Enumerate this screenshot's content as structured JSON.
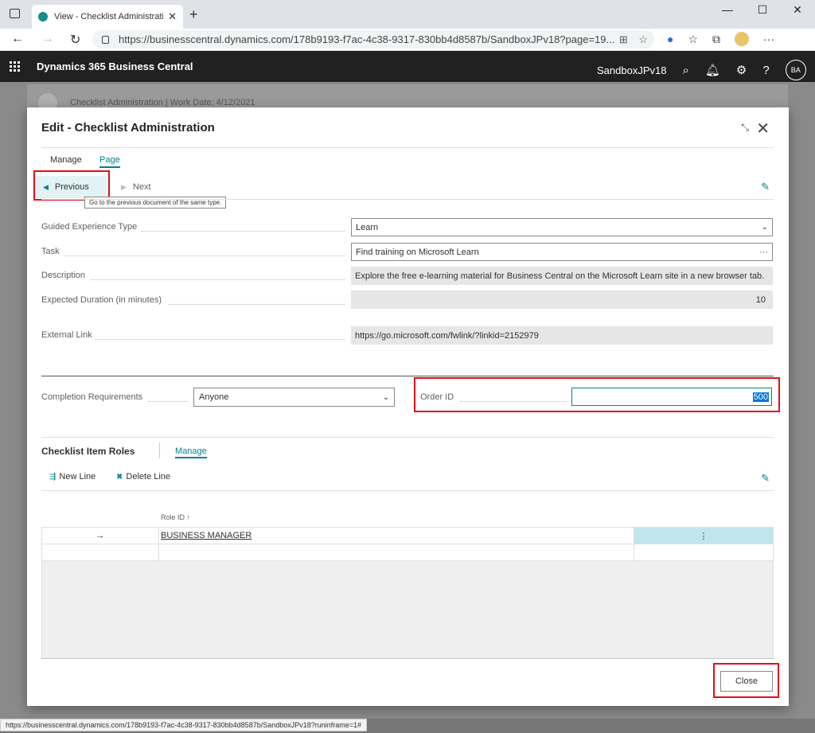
{
  "browser": {
    "tab_title": "View - Checklist Administration -",
    "url": "https://businesscentral.dynamics.com/178b9193-f7ac-4c38-9317-830bb4d8587b/SandboxJPv18?page=19...",
    "status_url": "https://businesscentral.dynamics.com/178b9193-f7ac-4c38-9317-830bb4d8587b/SandboxJPv18?runinframe=1#"
  },
  "app": {
    "title": "Dynamics 365 Business Central",
    "environment": "SandboxJPv18",
    "user_initials": "BA"
  },
  "background_page": {
    "title": "Checklist Administration | Work Date: 4/12/2021"
  },
  "dialog": {
    "title": "Edit - Checklist Administration",
    "menu": {
      "manage": "Manage",
      "page": "Page"
    },
    "actions": {
      "previous": "Previous",
      "next": "Next"
    },
    "tooltip": "Go to the previous document of the same type.",
    "fields": {
      "guided_type": {
        "label": "Guided Experience Type",
        "value": "Learn"
      },
      "task": {
        "label": "Task",
        "value": "Find training on Microsoft Learn"
      },
      "description": {
        "label": "Description",
        "value": "Explore the free e-learning material for Business Central on the Microsoft Learn site in a new browser tab."
      },
      "duration": {
        "label": "Expected Duration (in minutes)",
        "value": "10"
      },
      "external_link": {
        "label": "External Link",
        "value": "https://go.microsoft.com/fwlink/?linkid=2152979"
      },
      "completion": {
        "label": "Completion Requirements",
        "value": "Anyone"
      },
      "order_id": {
        "label": "Order ID",
        "value": "500"
      }
    },
    "roles": {
      "header": "Checklist Item Roles",
      "manage": "Manage",
      "new_line": "New Line",
      "delete_line": "Delete Line",
      "column": "Role ID ↑",
      "rows": [
        {
          "arrow": "→",
          "role_id": "BUSINESS MANAGER"
        }
      ]
    },
    "close": "Close"
  }
}
